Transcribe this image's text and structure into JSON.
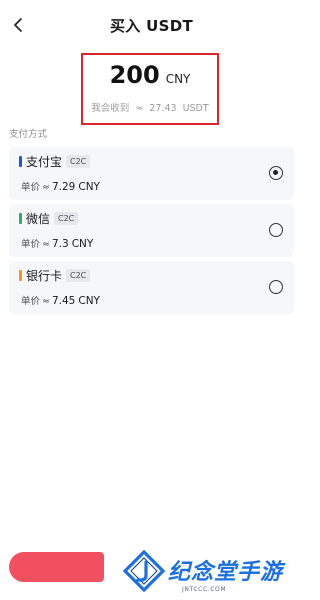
{
  "header": {
    "back_icon": "chevron-left-icon",
    "title": "买入 USDT"
  },
  "amount": {
    "value": "200",
    "unit": "CNY",
    "receive_label": "我会收到",
    "receive_approx": "≈",
    "receive_value": "27.43",
    "receive_unit": "USDT",
    "highlight_color": "#d9252b"
  },
  "payment": {
    "section_label": "支付方式",
    "methods": [
      {
        "name": "支付宝",
        "badge": "C2C",
        "color": "#1e58d6",
        "price_label": "单价",
        "price_approx": "≈",
        "price_value": "7.29",
        "price_unit": "CNY",
        "selected": true
      },
      {
        "name": "微信",
        "badge": "C2C",
        "color": "#27b06a",
        "price_label": "单价",
        "price_approx": "≈",
        "price_value": "7.3",
        "price_unit": "CNY",
        "selected": false
      },
      {
        "name": "银行卡",
        "badge": "C2C",
        "color": "#f0942c",
        "price_label": "单价",
        "price_approx": "≈",
        "price_value": "7.45",
        "price_unit": "CNY",
        "selected": false
      }
    ]
  },
  "bottom": {
    "button_color": "#f0505f"
  },
  "watermark": {
    "logo_icon": "j-diamond-logo",
    "text": "纪念堂手游",
    "subtext": "JNTCCC.COM",
    "color": "#1b6fe0"
  }
}
